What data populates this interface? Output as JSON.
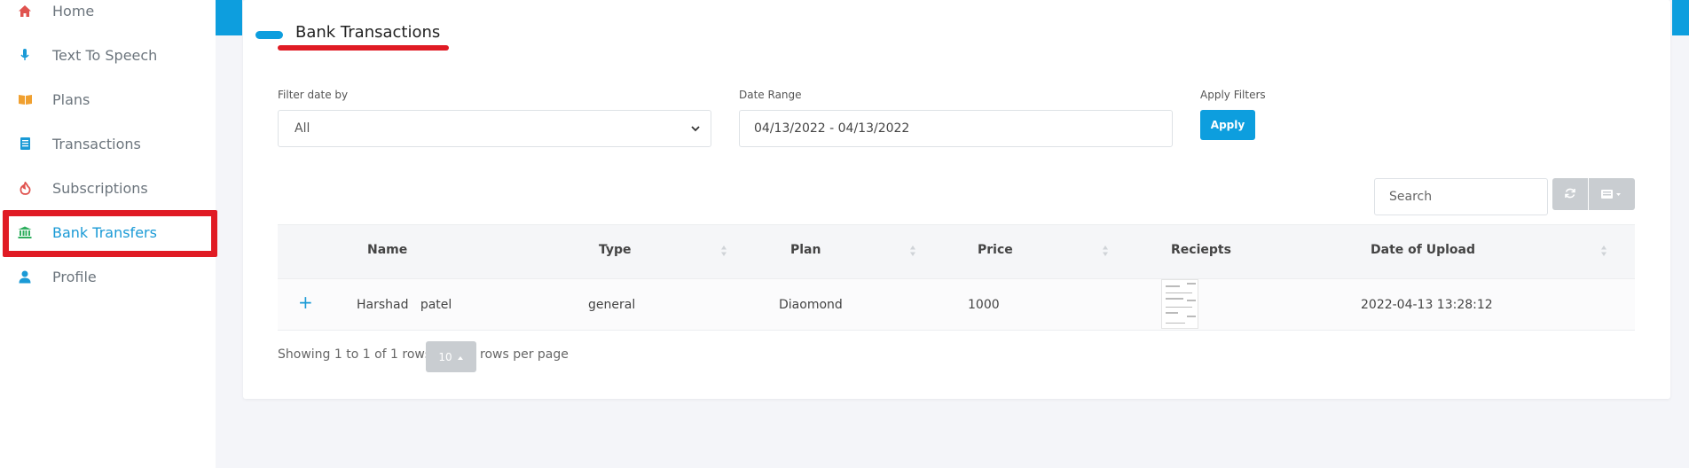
{
  "sidebar": {
    "items": [
      {
        "label": "Home",
        "icon": "home-icon",
        "color": "#e0534f"
      },
      {
        "label": "Text To Speech",
        "icon": "microphone-icon",
        "color": "#1a9ad6"
      },
      {
        "label": "Plans",
        "icon": "book-icon",
        "color": "#f0a030"
      },
      {
        "label": "Transactions",
        "icon": "list-icon",
        "color": "#1a9ad6"
      },
      {
        "label": "Subscriptions",
        "icon": "fire-icon",
        "color": "#e0534f"
      },
      {
        "label": "Bank Transfers",
        "icon": "bank-icon",
        "color": "#2eae5e",
        "active": true
      },
      {
        "label": "Profile",
        "icon": "user-icon",
        "color": "#1a9ad6"
      }
    ]
  },
  "page": {
    "title": "Bank Transactions"
  },
  "filters": {
    "filter_date_label": "Filter date by",
    "filter_date_value": "All",
    "date_range_label": "Date Range",
    "date_range_value": "04/13/2022 - 04/13/2022",
    "apply_label": "Apply Filters",
    "apply_button": "Apply"
  },
  "toolbar": {
    "search_placeholder": "Search"
  },
  "table": {
    "columns": [
      "Name",
      "Type",
      "Plan",
      "Price",
      "Reciepts",
      "Date of Upload"
    ],
    "rows": [
      {
        "expand": "+",
        "name": "Harshad   patel",
        "type": "general",
        "plan": "Diaomond",
        "price": "1000",
        "date": "2022-04-13 13:28:12"
      }
    ]
  },
  "pagination": {
    "showing": "Showing 1 to 1 of 1 rows",
    "per_page": "10",
    "per_page_suffix": "rows per page"
  },
  "colors": {
    "accent": "#0d9ede",
    "highlight": "#e01b24"
  }
}
